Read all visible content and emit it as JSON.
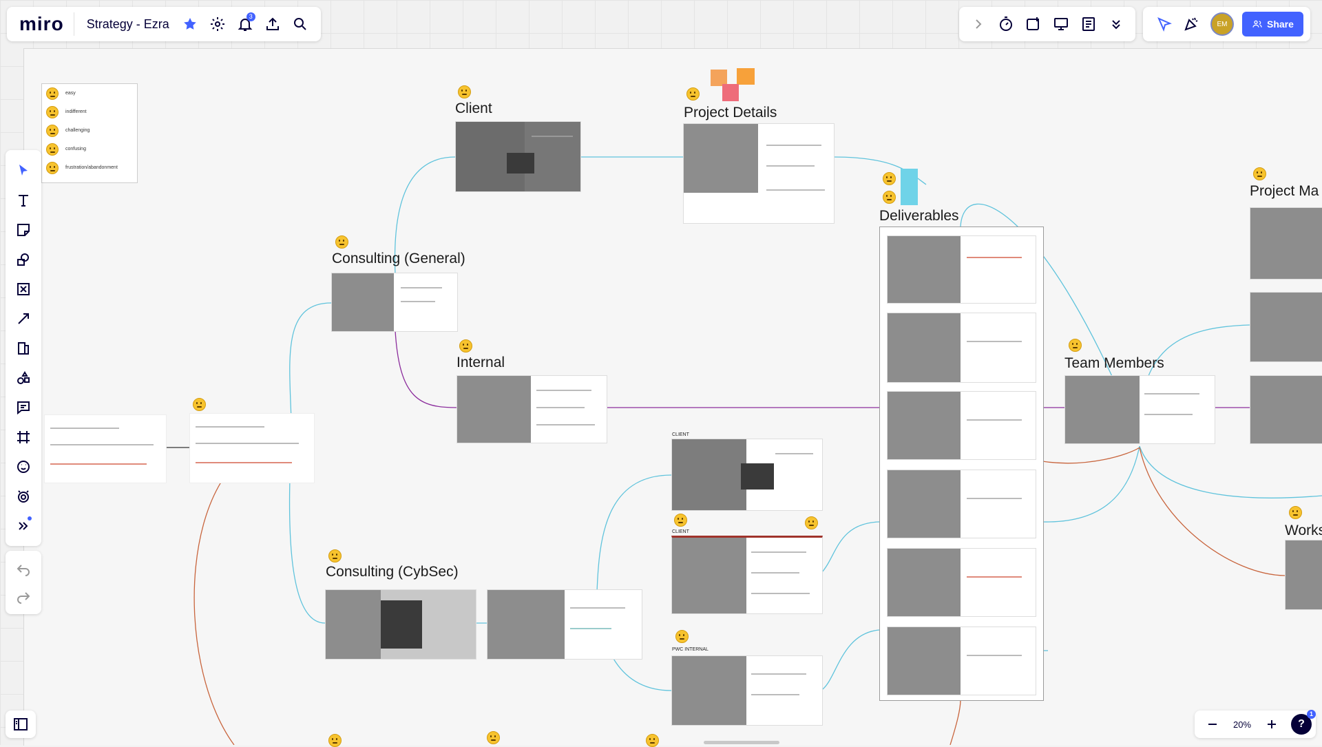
{
  "header": {
    "logo": "miro",
    "board_title": "Strategy - Ezra",
    "notification_count": "3",
    "avatar_initials": "EM",
    "share_label": "Share",
    "accent": "#4262ff"
  },
  "zoom": {
    "level": "20%",
    "help_badge": "1"
  },
  "legend": {
    "items": [
      {
        "icon": "smile-emoji-icon",
        "label": "easy"
      },
      {
        "icon": "neutral-emoji-icon",
        "label": "indifferent"
      },
      {
        "icon": "grimace-emoji-icon",
        "label": "challenging"
      },
      {
        "icon": "confused-emoji-icon",
        "label": "confusing"
      },
      {
        "icon": "frustrated-emoji-icon",
        "label": "frustration/abandonment"
      }
    ]
  },
  "frames": {
    "client": "Client",
    "project_details": "Project Details",
    "consulting_general": "Consulting (General)",
    "internal": "Internal",
    "deliverables": "Deliverables",
    "team_members": "Team Members",
    "project_ma": "Project Ma",
    "consulting_cybsec": "Consulting (CybSec)",
    "works": "Works"
  },
  "small_labels": {
    "client_upper_1": "CLIENT",
    "client_upper_2": "CLIENT",
    "pwc_internal": "PWC INTERNAL"
  },
  "colors": {
    "link_blue": "#5fc3dc",
    "link_purple": "#8b2c9c",
    "link_orange": "#c8643c"
  }
}
